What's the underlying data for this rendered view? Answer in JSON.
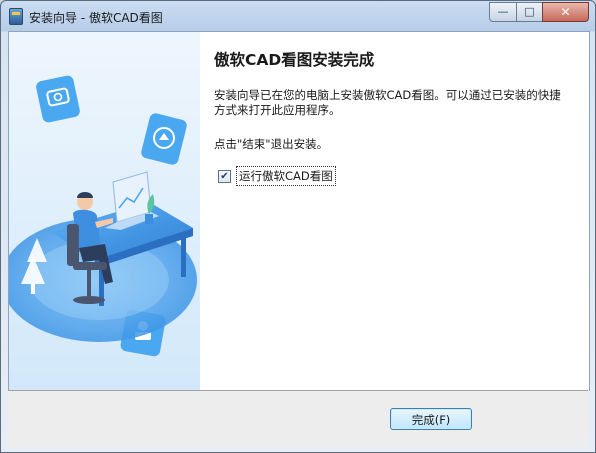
{
  "window": {
    "title": "安装向导 - 傲软CAD看图"
  },
  "title_controls": {
    "minimize": "—",
    "maximize": "□",
    "close": "✕"
  },
  "main": {
    "heading": "傲软CAD看图安装完成",
    "description": "安装向导已在您的电脑上安装傲软CAD看图。可以通过已安装的快捷方式来打开此应用程序。",
    "hint": "点击\"结束\"退出安装。",
    "run_checkbox": {
      "label": "运行傲软CAD看图",
      "checked": true,
      "mark": "✔"
    }
  },
  "footer": {
    "finish_button": "完成(F)"
  },
  "colors": {
    "accent": "#3c7fb1",
    "illustration_blue": "#4aa8f0"
  }
}
